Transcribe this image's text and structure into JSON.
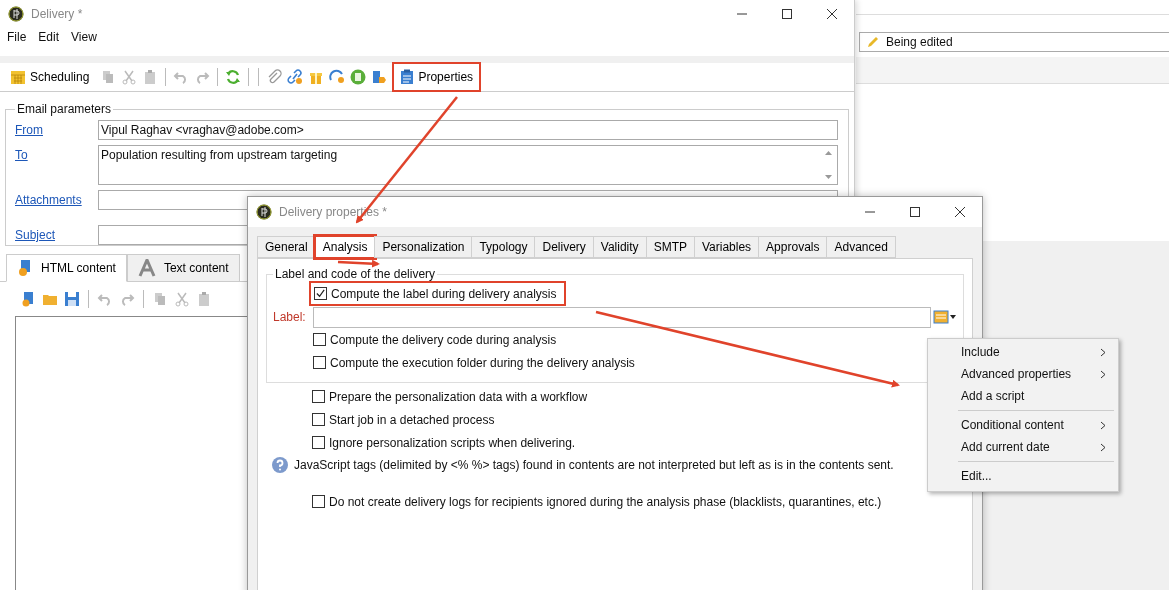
{
  "background_window": {
    "status_field": "Being edited"
  },
  "main_window": {
    "title": "Delivery *",
    "menu": [
      "File",
      "Edit",
      "View"
    ],
    "toolbar": {
      "scheduling": "Scheduling",
      "properties": {
        "label": "Properties",
        "highlighted": true
      }
    },
    "email_parameters": {
      "legend": "Email parameters",
      "fields": [
        {
          "label": "From",
          "value": "Vipul Raghav <vraghav@adobe.com>",
          "kind": "line"
        },
        {
          "label": "To",
          "value": "Population resulting from upstream targeting",
          "kind": "area"
        },
        {
          "label": "Attachments",
          "kind": "line"
        },
        {
          "label": "Subject",
          "kind": "line"
        }
      ]
    },
    "content_tabs": [
      {
        "label": "HTML content",
        "selected": true,
        "kind": "html"
      },
      {
        "label": "Text content",
        "selected": false,
        "kind": "text"
      }
    ]
  },
  "dialog": {
    "title": "Delivery properties *",
    "tabs": [
      {
        "label": "General",
        "selected": false,
        "highlighted": false
      },
      {
        "label": "Analysis",
        "selected": true,
        "highlighted": true
      },
      {
        "label": "Personalization",
        "selected": false,
        "highlighted": false
      },
      {
        "label": "Typology",
        "selected": false,
        "highlighted": false
      },
      {
        "label": "Delivery",
        "selected": false,
        "highlighted": false
      },
      {
        "label": "Validity",
        "selected": false,
        "highlighted": false
      },
      {
        "label": "SMTP",
        "selected": false,
        "highlighted": false
      },
      {
        "label": "Variables",
        "selected": false,
        "highlighted": false
      },
      {
        "label": "Approvals",
        "selected": false,
        "highlighted": false
      },
      {
        "label": "Advanced",
        "selected": false,
        "highlighted": false
      }
    ],
    "label_group": {
      "legend": "Label and code of the delivery",
      "compute_label": {
        "text": "Compute the label during delivery analysis",
        "checked": true,
        "highlighted": true
      },
      "label_field": {
        "label": "Label:"
      },
      "options": [
        {
          "text": "Compute the delivery code during analysis",
          "checked": false
        },
        {
          "text": "Compute the execution folder during the delivery analysis",
          "checked": false
        }
      ]
    },
    "options": [
      {
        "text": "Prepare the personalization data with a workflow",
        "checked": false
      },
      {
        "text": "Start job in a detached process",
        "checked": false
      },
      {
        "text": "Ignore personalization scripts when delivering.",
        "checked": false
      }
    ],
    "info": "JavaScript tags (delimited by <% %> tags) found in contents are not interpreted but left as is in the contents sent.",
    "logs_option": {
      "text": "Do not create delivery logs for recipients ignored during the analysis phase (blacklists, quarantines, etc.)",
      "checked": false
    }
  },
  "context_menu": {
    "groups": [
      [
        {
          "label": "Include",
          "submenu": true
        },
        {
          "label": "Advanced properties",
          "submenu": true
        },
        {
          "label": "Add a script",
          "submenu": false
        }
      ],
      [
        {
          "label": "Conditional content",
          "submenu": true
        },
        {
          "label": "Add current date",
          "submenu": true
        }
      ],
      [
        {
          "label": "Edit...",
          "submenu": false
        }
      ]
    ]
  }
}
